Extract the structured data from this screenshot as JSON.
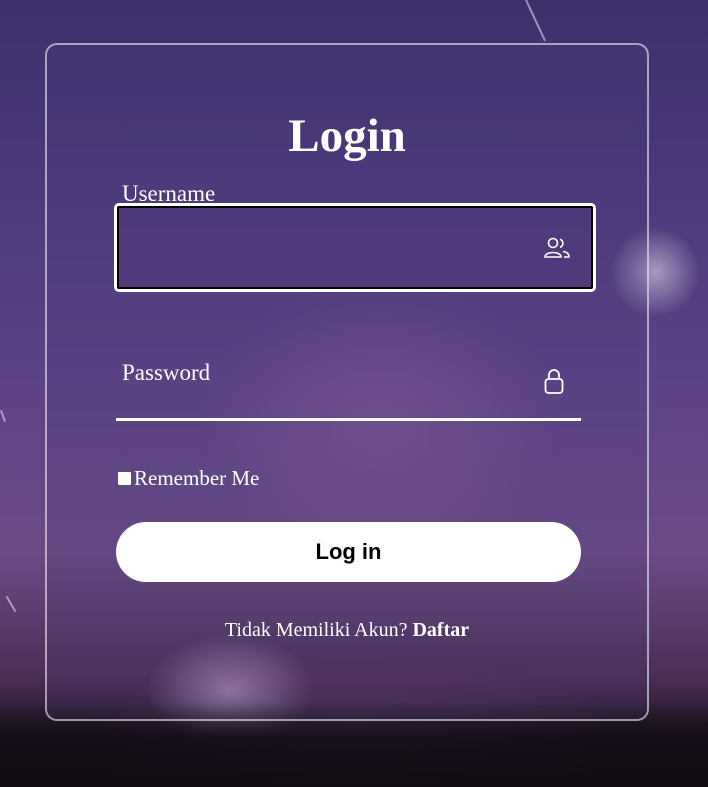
{
  "login": {
    "title": "Login",
    "username_label": "Username",
    "username_value": "",
    "password_label": "Password",
    "password_value": "",
    "remember_label": "Remember Me",
    "remember_checked": false,
    "submit_label": "Log in",
    "signup_prompt": "Tidak Memiliki Akun?",
    "signup_link": "Daftar"
  },
  "icons": {
    "username": "users-icon",
    "password": "lock-icon"
  },
  "colors": {
    "card_border": "#ffffff",
    "text": "#ffffff",
    "button_bg": "#ffffff",
    "button_text": "#000000"
  }
}
